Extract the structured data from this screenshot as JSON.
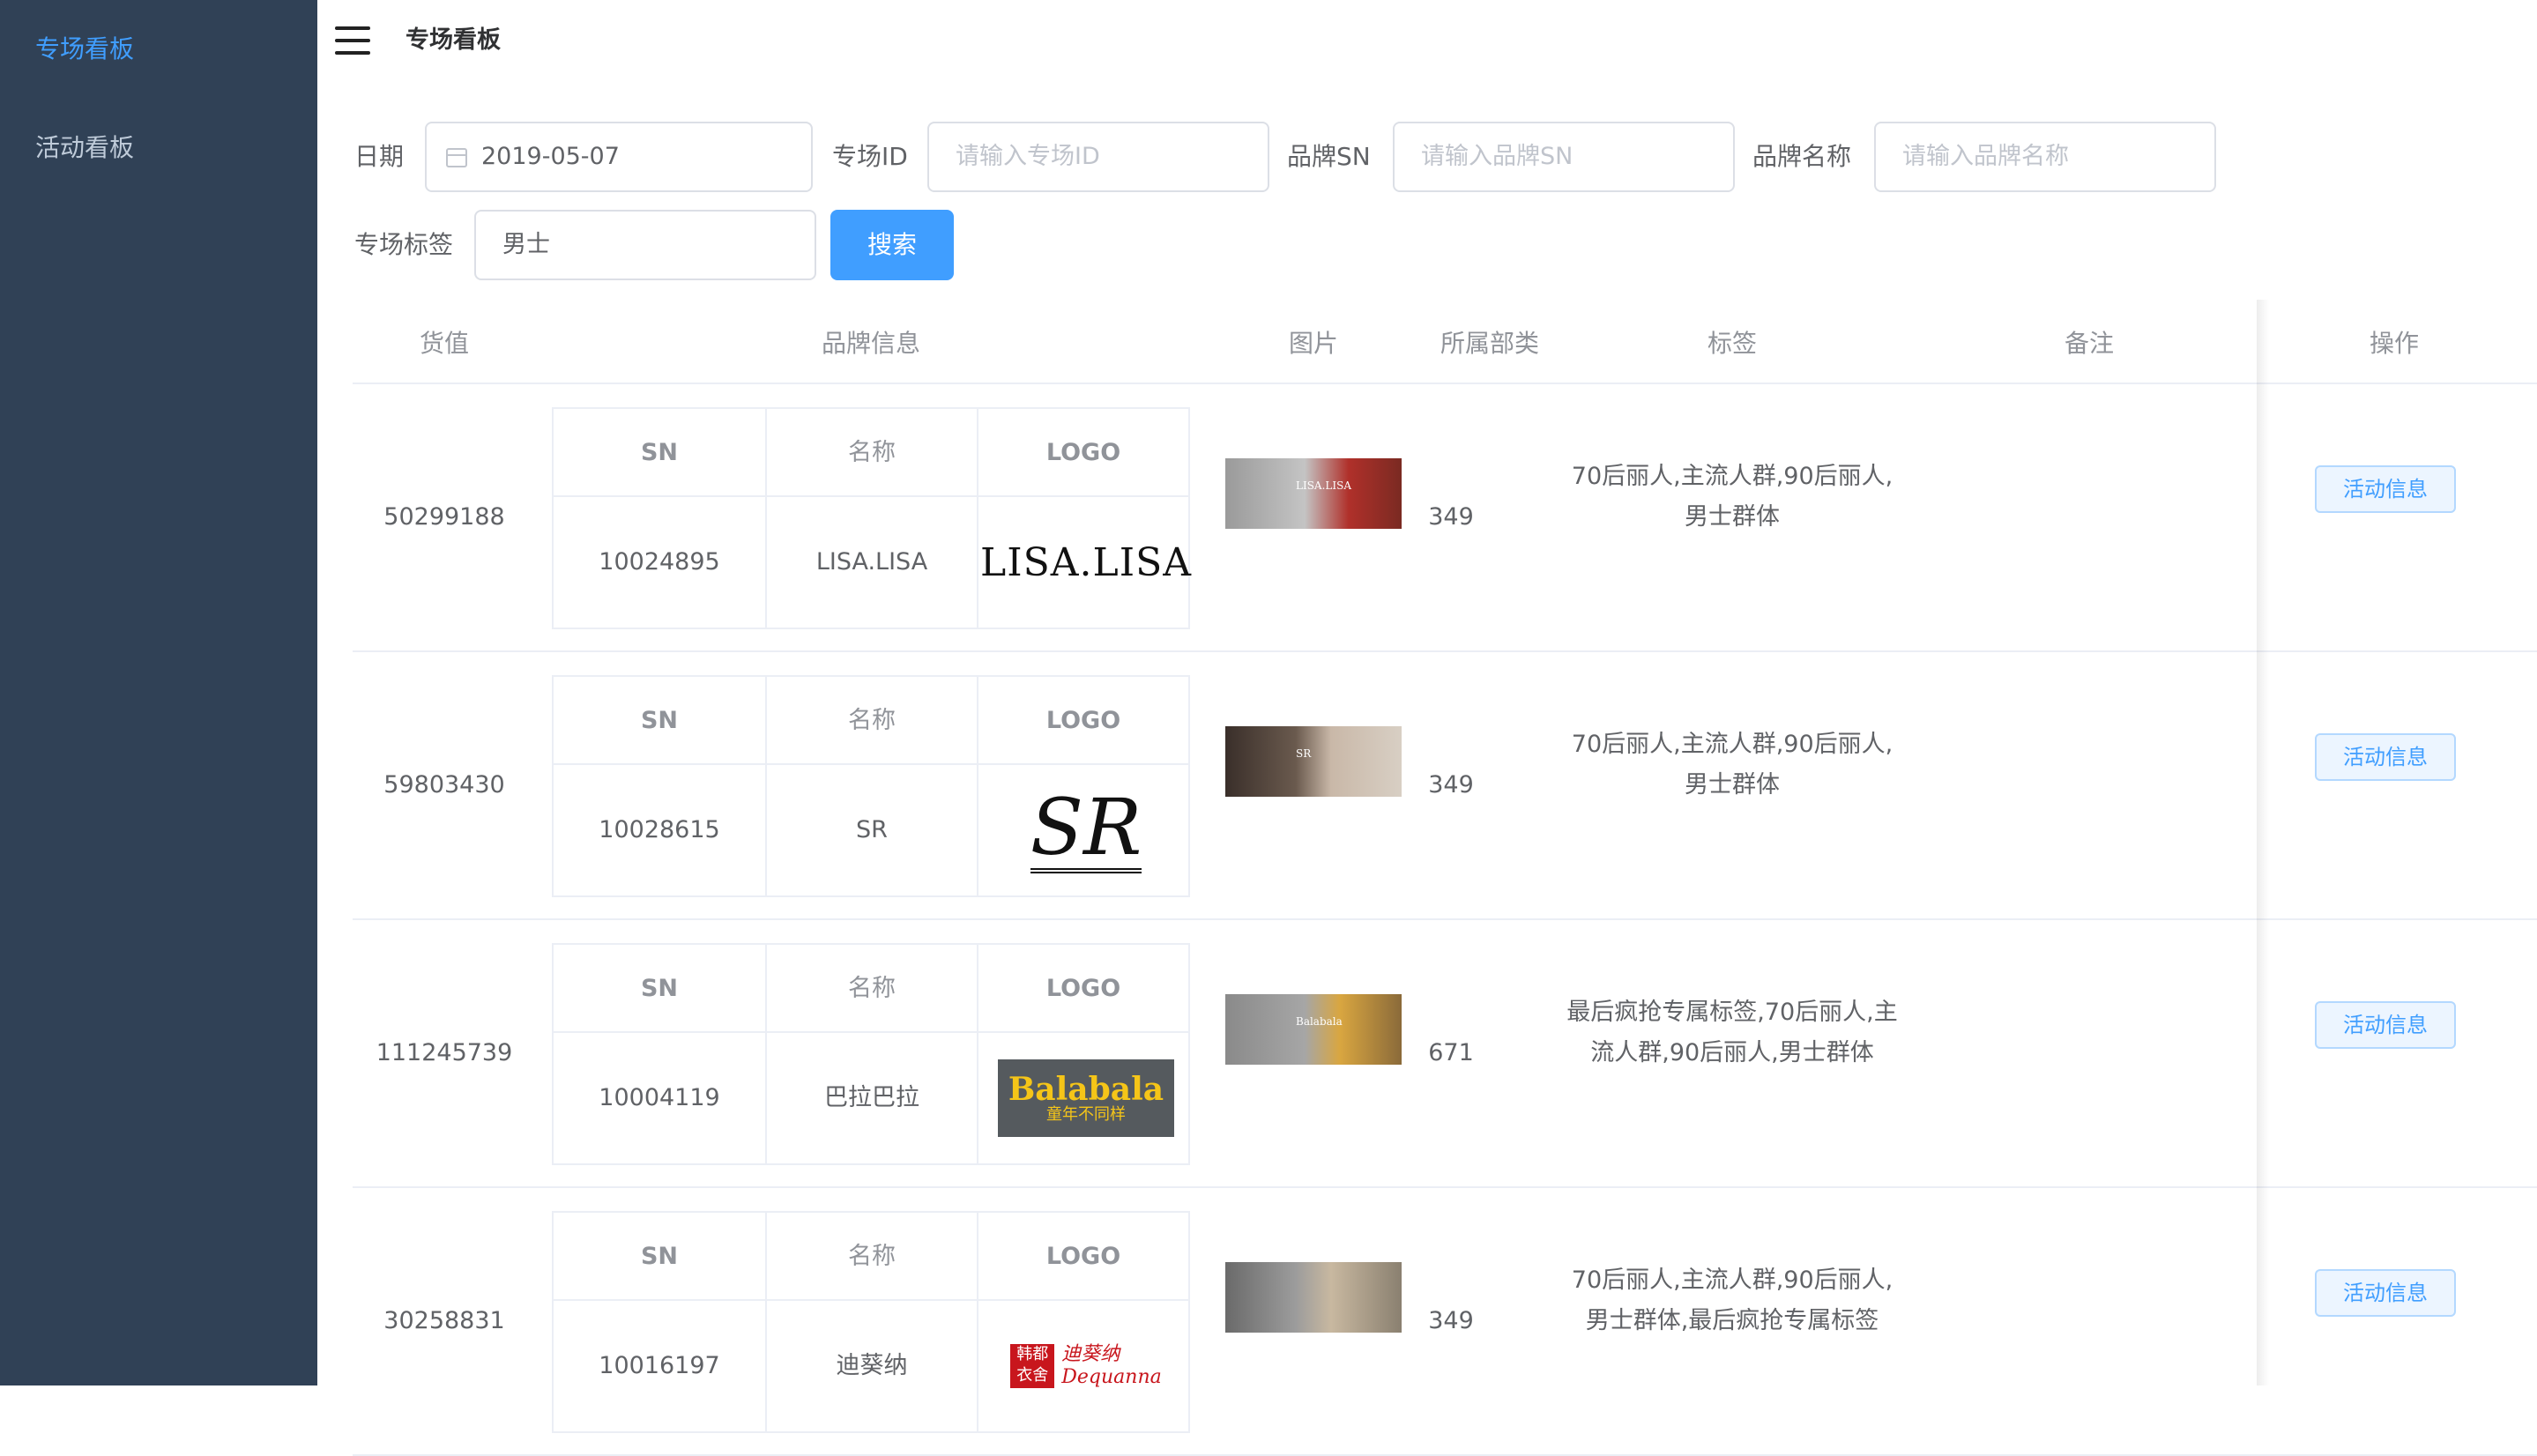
{
  "sidebar": {
    "items": [
      {
        "label": "专场看板",
        "active": true
      },
      {
        "label": "活动看板",
        "active": false
      }
    ]
  },
  "header": {
    "title": "专场看板"
  },
  "filters": {
    "date_label": "日期",
    "date_value": "2019-05-07",
    "special_id_label": "专场ID",
    "special_id_placeholder": "请输入专场ID",
    "brand_sn_label": "品牌SN",
    "brand_sn_placeholder": "请输入品牌SN",
    "brand_name_label": "品牌名称",
    "brand_name_placeholder": "请输入品牌名称",
    "tag_label": "专场标签",
    "tag_value": "男士",
    "search_label": "搜索"
  },
  "table": {
    "headers": {
      "value": "货值",
      "brand": "品牌信息",
      "image": "图片",
      "category": "所属部类",
      "tags": "标签",
      "remark": "备注",
      "action": "操作"
    },
    "brand_headers": {
      "sn": "SN",
      "name": "名称",
      "logo": "LOGO"
    },
    "action_label": "活动信息",
    "rows": [
      {
        "value": "50299188",
        "sn": "10024895",
        "name": "LISA.LISA",
        "logo_text": "LISA.LISA",
        "thumb_text": "LISA.LISA",
        "category": "349",
        "tags": "70后丽人,主流人群,90后丽人,男士群体",
        "remark": ""
      },
      {
        "value": "59803430",
        "sn": "10028615",
        "name": "SR",
        "logo_text": "SR",
        "thumb_text": "SR",
        "category": "349",
        "tags": "70后丽人,主流人群,90后丽人,男士群体",
        "remark": ""
      },
      {
        "value": "111245739",
        "sn": "10004119",
        "name": "巴拉巴拉",
        "logo_text": "Balabala",
        "logo_sub": "童年不同样",
        "thumb_text": "Balabala",
        "category": "671",
        "tags": "最后疯抢专属标签,70后丽人,主流人群,90后丽人,男士群体",
        "remark": ""
      },
      {
        "value": "30258831",
        "sn": "10016197",
        "name": "迪葵纳",
        "logo_seal": "韩都衣舍",
        "logo_text": "迪葵纳",
        "logo_sub": "Dequanna",
        "thumb_text": "",
        "category": "349",
        "tags": "70后丽人,主流人群,90后丽人,男士群体,最后疯抢专属标签",
        "remark": ""
      }
    ]
  },
  "colors": {
    "sidebar_bg": "#304156",
    "accent": "#409eff",
    "border": "#ebeef5"
  }
}
